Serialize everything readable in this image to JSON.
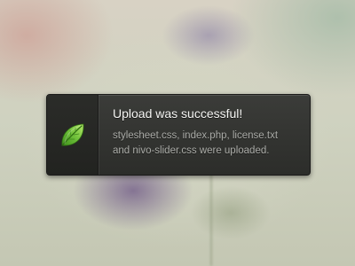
{
  "notification": {
    "title": "Upload was successful!",
    "message_lines": [
      "stylesheet.css, index.php, license.txt",
      "and nivo-slider.css were uploaded."
    ],
    "icon": "leaf-icon"
  },
  "colors": {
    "toast_background": "#333431",
    "title_text": "#f4f4f2",
    "message_text": "#a9aaa6",
    "leaf_green": "#6fc03a"
  }
}
